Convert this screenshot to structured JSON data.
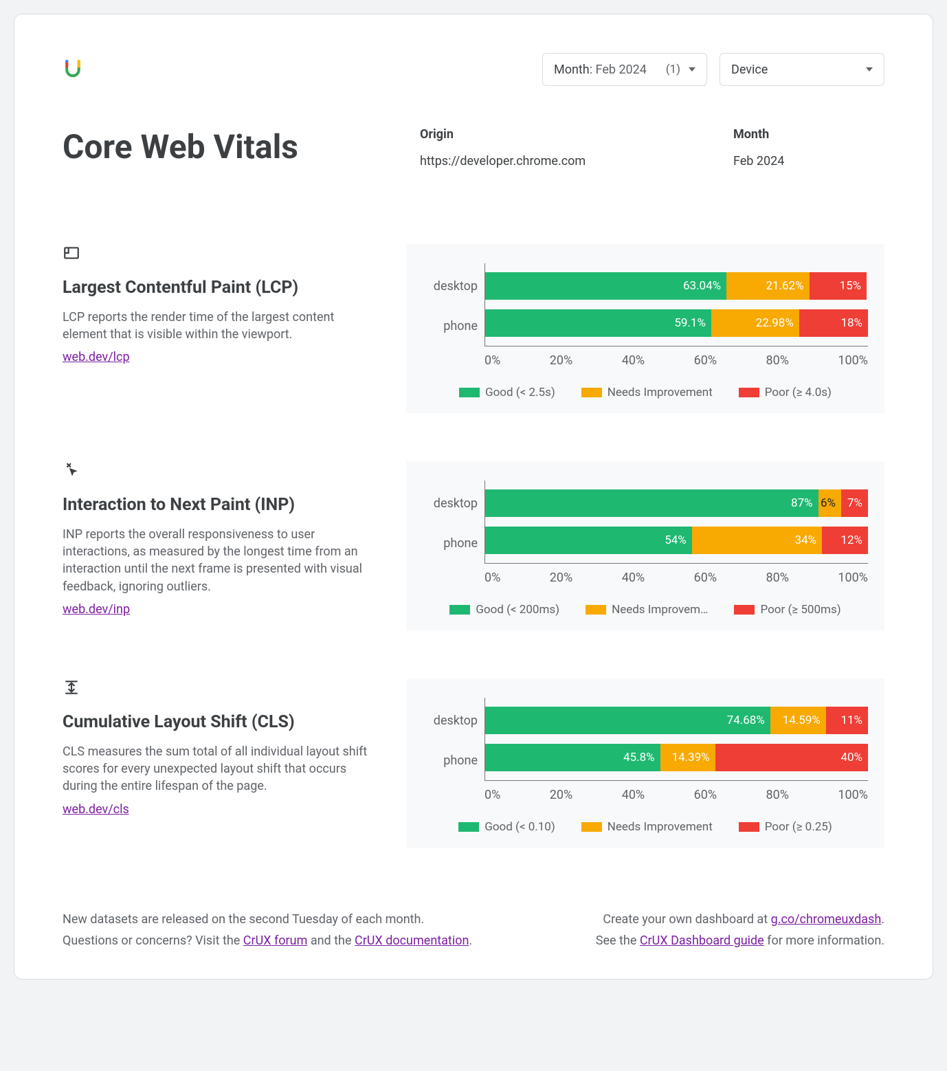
{
  "filters": {
    "month_label": "Month",
    "month_value": ": Feb 2024",
    "month_count": "(1)",
    "device_label": "Device"
  },
  "header": {
    "title": "Core Web Vitals",
    "origin_label": "Origin",
    "origin_value": "https://developer.chrome.com",
    "month_label": "Month",
    "month_value": "Feb 2024"
  },
  "axis_ticks": [
    "0%",
    "20%",
    "40%",
    "60%",
    "80%",
    "100%"
  ],
  "colors": {
    "good": "#1fb871",
    "ni": "#f8a902",
    "poor": "#ee3e36"
  },
  "metrics": [
    {
      "id": "lcp",
      "title": "Largest Contentful Paint (LCP)",
      "desc": "LCP reports the render time of the largest content element that is visible within the viewport.",
      "link": "web.dev/lcp",
      "legend": {
        "good": "Good (< 2.5s)",
        "ni": "Needs Improvement",
        "poor": "Poor (≥ 4.0s)"
      },
      "rows": [
        {
          "label": "desktop",
          "good": 63.04,
          "good_txt": "63.04%",
          "ni": 21.62,
          "ni_txt": "21.62%",
          "poor": 15,
          "poor_txt": "15%"
        },
        {
          "label": "phone",
          "good": 59.1,
          "good_txt": "59.1%",
          "ni": 22.98,
          "ni_txt": "22.98%",
          "poor": 18,
          "poor_txt": "18%"
        }
      ]
    },
    {
      "id": "inp",
      "title": "Interaction to Next Paint (INP)",
      "desc": "INP reports the overall responsiveness to user interactions, as measured by the longest time from an interaction until the next frame is presented with visual feedback, ignoring outliers.",
      "link": "web.dev/inp",
      "legend": {
        "good": "Good (< 200ms)",
        "ni": "Needs Improvem…",
        "poor": "Poor (≥ 500ms)"
      },
      "rows": [
        {
          "label": "desktop",
          "good": 87,
          "good_txt": "87%",
          "ni": 6,
          "ni_txt": "6%",
          "poor": 7,
          "poor_txt": "7%"
        },
        {
          "label": "phone",
          "good": 54,
          "good_txt": "54%",
          "ni": 34,
          "ni_txt": "34%",
          "poor": 12,
          "poor_txt": "12%"
        }
      ]
    },
    {
      "id": "cls",
      "title": "Cumulative Layout Shift (CLS)",
      "desc": "CLS measures the sum total of all individual layout shift scores for every unexpected layout shift that occurs during the entire lifespan of the page.",
      "link": "web.dev/cls",
      "legend": {
        "good": "Good (< 0.10)",
        "ni": "Needs Improvement",
        "poor": "Poor (≥ 0.25)"
      },
      "rows": [
        {
          "label": "desktop",
          "good": 74.68,
          "good_txt": "74.68%",
          "ni": 14.59,
          "ni_txt": "14.59%",
          "poor": 11,
          "poor_txt": "11%"
        },
        {
          "label": "phone",
          "good": 45.8,
          "good_txt": "45.8%",
          "ni": 14.39,
          "ni_txt": "14.39%",
          "poor": 40,
          "poor_txt": "40%"
        }
      ]
    }
  ],
  "footer": {
    "left_line1": "New datasets are released on the second Tuesday of each month.",
    "left_line2a": "Questions or concerns? Visit the ",
    "left_link1": "CrUX forum",
    "left_line2b": " and the ",
    "left_link2": "CrUX documentation",
    "left_line2c": ".",
    "right_line1a": "Create your own dashboard at ",
    "right_link1": "g.co/chromeuxdash",
    "right_line1b": ".",
    "right_line2a": "See the ",
    "right_link2": "CrUX Dashboard guide",
    "right_line2b": " for more information."
  },
  "chart_data": [
    {
      "type": "bar",
      "title": "Largest Contentful Paint (LCP)",
      "orientation": "horizontal-stacked",
      "categories": [
        "desktop",
        "phone"
      ],
      "series": [
        {
          "name": "Good (< 2.5s)",
          "values": [
            63.04,
            59.1
          ]
        },
        {
          "name": "Needs Improvement",
          "values": [
            21.62,
            22.98
          ]
        },
        {
          "name": "Poor (≥ 4.0s)",
          "values": [
            15,
            18
          ]
        }
      ],
      "xlim": [
        0,
        100
      ],
      "xlabel": "%",
      "ylabel": ""
    },
    {
      "type": "bar",
      "title": "Interaction to Next Paint (INP)",
      "orientation": "horizontal-stacked",
      "categories": [
        "desktop",
        "phone"
      ],
      "series": [
        {
          "name": "Good (< 200ms)",
          "values": [
            87,
            54
          ]
        },
        {
          "name": "Needs Improvement",
          "values": [
            6,
            34
          ]
        },
        {
          "name": "Poor (≥ 500ms)",
          "values": [
            7,
            12
          ]
        }
      ],
      "xlim": [
        0,
        100
      ],
      "xlabel": "%",
      "ylabel": ""
    },
    {
      "type": "bar",
      "title": "Cumulative Layout Shift (CLS)",
      "orientation": "horizontal-stacked",
      "categories": [
        "desktop",
        "phone"
      ],
      "series": [
        {
          "name": "Good (< 0.10)",
          "values": [
            74.68,
            45.8
          ]
        },
        {
          "name": "Needs Improvement",
          "values": [
            14.59,
            14.39
          ]
        },
        {
          "name": "Poor (≥ 0.25)",
          "values": [
            11,
            40
          ]
        }
      ],
      "xlim": [
        0,
        100
      ],
      "xlabel": "%",
      "ylabel": ""
    }
  ]
}
